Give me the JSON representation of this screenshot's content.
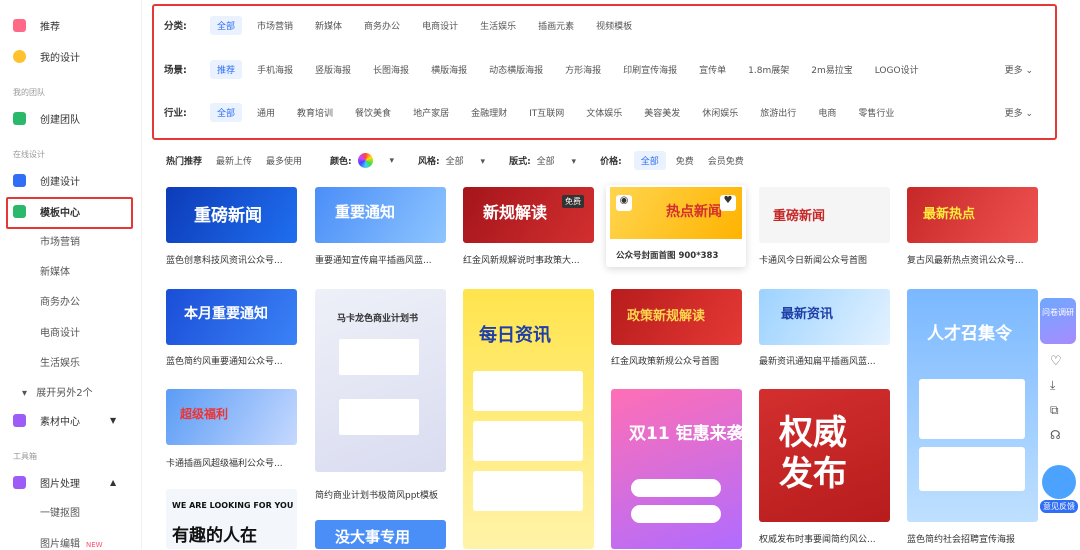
{
  "sidebar": {
    "recommend": "推荐",
    "my_design": "我的设计",
    "team_section": "我的团队",
    "create_team": "创建团队",
    "online_section": "在线设计",
    "create_design": "创建设计",
    "template_center": "模板中心",
    "sub_items": [
      "市场营销",
      "新媒体",
      "商务办公",
      "电商设计",
      "生活娱乐"
    ],
    "expand": "展开另外2个",
    "materials": "素材中心",
    "tools_section": "工具箱",
    "image_process": "图片处理",
    "cutout": "一键抠图",
    "image_edit": "图片编辑",
    "new_badge": "NEW"
  },
  "filters": {
    "category_title": "分类:",
    "categories": [
      "全部",
      "市场营销",
      "新媒体",
      "商务办公",
      "电商设计",
      "生活娱乐",
      "插画元素",
      "视频模板"
    ],
    "scene_title": "场景:",
    "scenes": [
      "推荐",
      "手机海报",
      "竖版海报",
      "长图海报",
      "横版海报",
      "动态横版海报",
      "方形海报",
      "印刷宣传海报",
      "宣传单",
      "1.8m展架",
      "2m易拉宝",
      "LOGO设计"
    ],
    "industry_title": "行业:",
    "industries": [
      "全部",
      "通用",
      "教育培训",
      "餐饮美食",
      "地产家居",
      "金融理财",
      "IT互联网",
      "文体娱乐",
      "美容美发",
      "休闲娱乐",
      "旅游出行",
      "电商",
      "零售行业"
    ],
    "more": "更多"
  },
  "sortbar": {
    "hot": "热门推荐",
    "latest": "最新上传",
    "most_used": "最多使用",
    "color": "颜色:",
    "style": "风格:",
    "style_val": "全部",
    "layout": "版式:",
    "layout_val": "全部",
    "price": "价格:",
    "price_all": "全部",
    "price_free": "免费",
    "price_member": "会员免费"
  },
  "cards": [
    {
      "caption": "蓝色创意科技风资讯公众号...",
      "title": "重磅新闻"
    },
    {
      "caption": "重要通知宣传扁平插画风蓝...",
      "title": "重要通知"
    },
    {
      "caption": "红金风新规解说时事政策大...",
      "title": "新规解读",
      "badge": "免费"
    },
    {
      "caption": "公众号封面首图 900*383",
      "title": "热点新闻"
    },
    {
      "caption": "卡通风今日新闻公众号首图",
      "title": "重磅新闻"
    },
    {
      "caption": "复古风最新热点资讯公众号...",
      "title": "最新热点"
    },
    {
      "caption": "蓝色简约风重要通知公众号...",
      "title": "本月重要通知"
    },
    {
      "caption": "简约商业计划书极简风ppt模板",
      "title": "马卡龙色商业计划书"
    },
    {
      "caption": "",
      "title": "每日资讯"
    },
    {
      "caption": "红金风政策新规公众号首图",
      "title": "政策新规解读"
    },
    {
      "caption": "最新资讯通知扁平插画风蓝...",
      "title": "最新资讯"
    },
    {
      "caption": "",
      "title": "人才召集令"
    },
    {
      "caption": "卡通插画风超级福利公众号...",
      "title": "超级福利"
    },
    {
      "caption": "",
      "title": "双11 钜惠来袭"
    },
    {
      "caption": "权威发布时事要闻简约风公...",
      "title": "权威发布"
    },
    {
      "caption": "蓝色简约社会招聘宣传海报",
      "title": ""
    },
    {
      "caption": "",
      "title": "有趣的人在"
    },
    {
      "caption": "",
      "title": "没大事专用"
    }
  ],
  "right_tools": {
    "feedback": "意见反馈",
    "float_label": "问卷调研"
  },
  "colors": {
    "accent": "#2f6ef5",
    "highlight": "#e53935"
  }
}
